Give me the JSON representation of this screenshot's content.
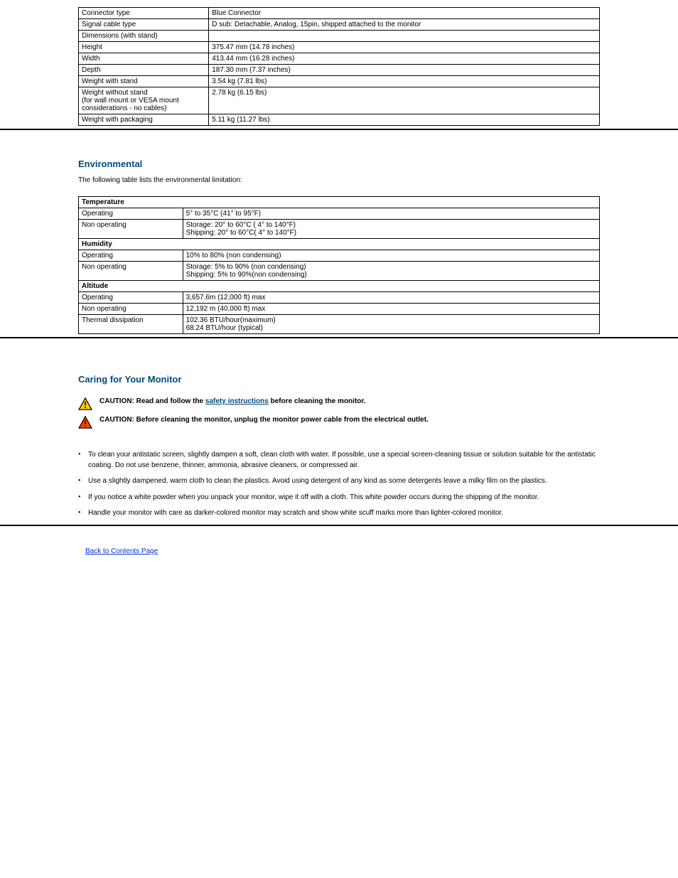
{
  "physical": {
    "rows": [
      {
        "k": "Connector type",
        "v": "Blue Connector"
      },
      {
        "k": "Signal cable type",
        "v": "D sub: Detachable, Analog, 15pin, shipped attached to the monitor"
      },
      {
        "k": "Dimensions (with stand)",
        "v": ""
      },
      {
        "k": "Height",
        "v": "375.47 mm (14.78 inches)"
      },
      {
        "k": "Width",
        "v": "413.44 mm (16.28 inches)"
      },
      {
        "k": "Depth",
        "v": "187.30 mm (7.37 inches)"
      },
      {
        "k": "Weight  with stand",
        "v": "3.54 kg (7.81 lbs)"
      },
      {
        "k": "Weight  without stand",
        "sub": "(for wall mount or VESA mount considerations - no cables)",
        "v": "2.78 kg (6.15 lbs)"
      },
      {
        "k": "Weight  with packaging",
        "v": "5.11 kg (11.27 lbs)"
      }
    ]
  },
  "env": {
    "title": "Environmental",
    "intro": "The following table lists the environmental limitation:",
    "groups": [
      {
        "header": "Temperature",
        "rows": [
          {
            "k": "Operating",
            "v": "5° to 35°C (41° to 95°F)"
          }
        ],
        "multirow": {
          "k": "Non operating",
          "lines": [
            "Storage:   20° to 60°C (  4° to 140°F)",
            "Shipping:   20° to 60°C(  4° to 140°F)"
          ]
        }
      },
      {
        "header": "Humidity",
        "rows": [
          {
            "k": "Operating",
            "v": "10% to 80% (non condensing)"
          }
        ],
        "multirow": {
          "k": "Non operating",
          "lines": [
            "Storage: 5% to 90% (non condensing)",
            "Shipping: 5% to 90%(non condensing)"
          ]
        }
      },
      {
        "header": "Altitude",
        "rows": [
          {
            "k": "Operating",
            "v": "3,657.6m (12,000 ft) max"
          },
          {
            "k": "Non operating",
            "v": "12,192 m (40,000 ft) max"
          }
        ],
        "multirow": null
      },
      {
        "header": null,
        "rows": [
          {
            "k": "Thermal dissipation",
            "v": "102.36 BTU/hour(maximum)\n68.24 BTU/hour (typical)"
          }
        ],
        "multirow": null
      }
    ]
  },
  "care": {
    "title": "Caring for Your Monitor",
    "caution1_pre": "CAUTION: Read and follow the ",
    "caution1_link": "safety instructions",
    "caution1_post": " before cleaning the monitor.",
    "caution2": "CAUTION: Before cleaning the monitor, unplug the monitor power cable from the electrical outlet.",
    "bullets": [
      "To clean your antistatic screen, slightly dampen a soft, clean cloth with water. If possible, use a special screen-cleaning tissue or solution suitable for the antistatic coating. Do not use benzene, thinner, ammonia, abrasive cleaners, or compressed air.",
      "Use a slightly dampened, warm cloth to clean the plastics. Avoid using detergent of any kind as some detergents leave a milky film on the plastics.",
      "If you notice a white powder when you unpack your monitor, wipe it off with a cloth. This white powder occurs during the shipping of the monitor.",
      "Handle your monitor with care as darker-colored monitor may scratch and show white scuff marks more than lighter-colored monitor."
    ]
  },
  "back": "Back to Contents Page",
  "nonop": "Non-operating"
}
